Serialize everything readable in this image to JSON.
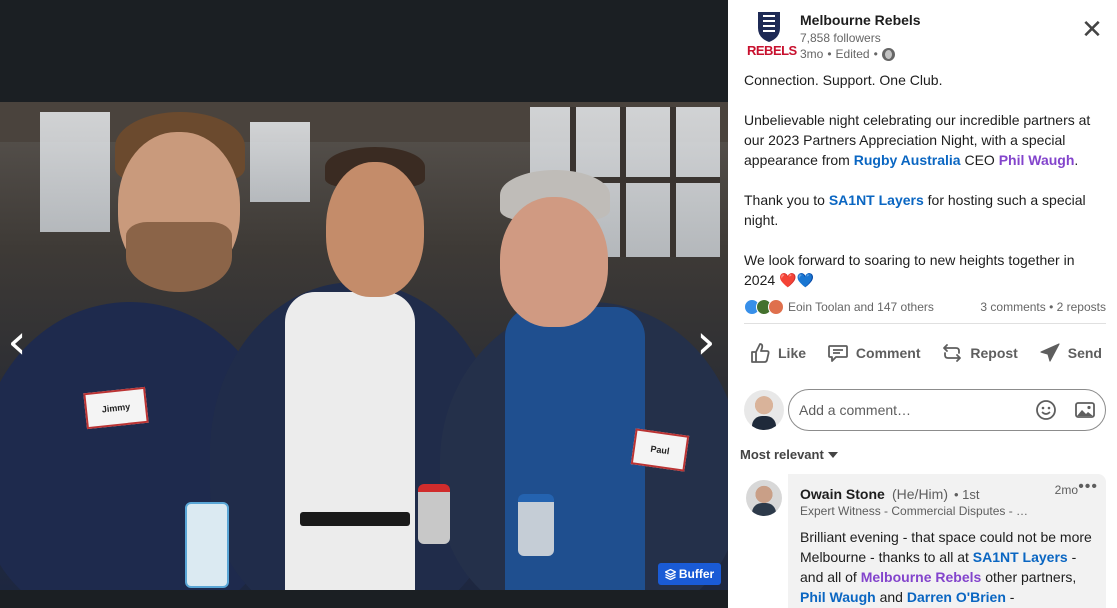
{
  "post": {
    "org_name": "Melbourne Rebels",
    "logo_text": "REBELS",
    "followers": "7,858 followers",
    "age": "3mo",
    "edited": "Edited",
    "paragraphs": {
      "p1": "Connection. Support. One Club.",
      "p2_a": "Unbelievable night celebrating our incredible partners at our 2023 Partners Appreciation Night, with a special appearance from ",
      "p2_link1": "Rugby Australia",
      "p2_b": " CEO ",
      "p2_link2": "Phil Waugh",
      "p2_c": ".",
      "p3_a": "Thank you to ",
      "p3_link": "SA1NT Layers",
      "p3_b": " for hosting such a special night.",
      "p4": "We look forward to soaring to new heights together in 2024 ",
      "p4_emoji": "❤️💙"
    }
  },
  "social": {
    "reactors": "Eoin Toolan and 147 others",
    "counts": "3 comments • 2 reposts"
  },
  "actions": {
    "like": "Like",
    "comment": "Comment",
    "repost": "Repost",
    "send": "Send"
  },
  "composer": {
    "placeholder": "Add a comment…"
  },
  "sort": {
    "label": "Most relevant"
  },
  "comment": {
    "name": "Owain Stone",
    "pronouns": "(He/Him)",
    "degree": "• 1st",
    "time": "2mo",
    "more": "•••",
    "headline": "Expert Witness - Commercial Disputes - …",
    "t1": "Brilliant evening - that space could not be more Melbourne - thanks to all at ",
    "t1_link": "SA1NT Layers",
    "t2": " - and all of ",
    "t2_link": "Melbourne Rebels",
    "t3": " other partners, ",
    "t3_link1": "Phil Waugh",
    "t3_and": " and ",
    "t3_link2": "Darren O'Brien",
    "t3_end": " -"
  },
  "photo": {
    "badge_left": "Jimmy",
    "badge_right": "Paul",
    "buffer_label": "Buffer",
    "prev": "‹",
    "next": "›"
  },
  "icons": {
    "close": "close-icon",
    "globe": "globe-icon",
    "like": "thumbs-up-icon",
    "comment": "speech-bubble-icon",
    "repost": "repost-arrows-icon",
    "send": "paper-plane-icon",
    "emoji": "smiley-icon",
    "image": "image-icon"
  },
  "colors": {
    "link_blue": "#0a66c2",
    "mention_purple": "#8344cc",
    "buffer_blue": "#1a5bd6",
    "viewer_bg": "#1b1f23"
  }
}
